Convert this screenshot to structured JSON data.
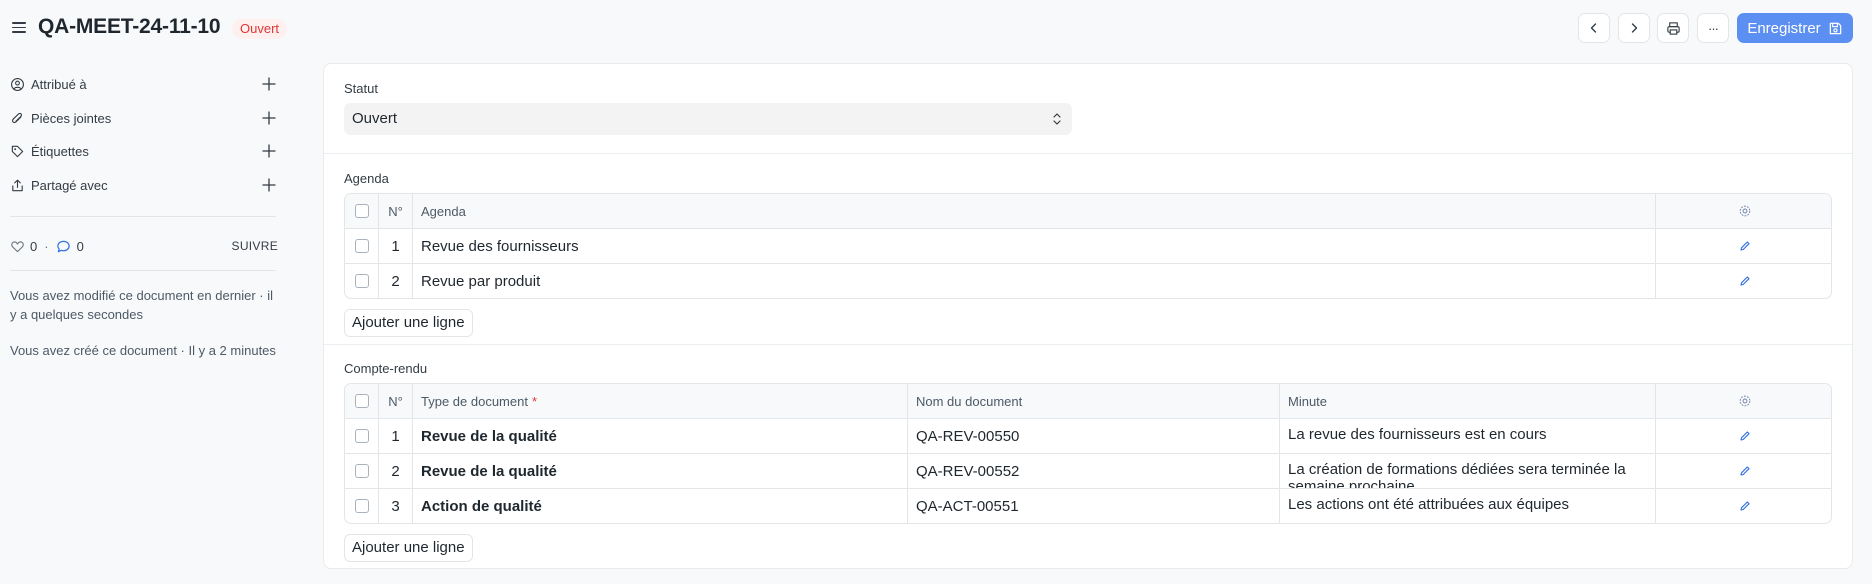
{
  "header": {
    "title": "QA-MEET-24-11-10",
    "status": "Ouvert",
    "save_label": "Enregistrer",
    "more_label": "···"
  },
  "sidebar": {
    "items": [
      {
        "label": "Attribué à",
        "icon": "user-assign-icon"
      },
      {
        "label": "Pièces jointes",
        "icon": "paperclip-icon"
      },
      {
        "label": "Étiquettes",
        "icon": "tag-icon"
      },
      {
        "label": "Partagé avec",
        "icon": "share-icon"
      }
    ],
    "likes": "0",
    "comments": "0",
    "separator": "·",
    "follow_label": "SUIVRE",
    "activity": [
      "Vous avez modifié ce document en dernier · il y a quelques secondes",
      "Vous avez créé ce document · Il y a 2 minutes"
    ]
  },
  "main": {
    "status_label": "Statut",
    "status_value": "Ouvert",
    "agenda": {
      "label": "Agenda",
      "columns": [
        "N°",
        "Agenda"
      ],
      "rows": [
        {
          "no": "1",
          "agenda": "Revue des fournisseurs"
        },
        {
          "no": "2",
          "agenda": "Revue par produit"
        }
      ],
      "add_label": "Ajouter une ligne"
    },
    "minutes": {
      "label": "Compte-rendu",
      "columns": [
        "N°",
        "Type de document",
        "Nom du document",
        "Minute"
      ],
      "required_mark": "*",
      "rows": [
        {
          "no": "1",
          "type": "Revue de la qualité",
          "name": "QA-REV-00550",
          "minute": "La revue des fournisseurs est en cours"
        },
        {
          "no": "2",
          "type": "Revue de la qualité",
          "name": "QA-REV-00552",
          "minute": "La création de formations dédiées sera terminée la semaine prochaine"
        },
        {
          "no": "3",
          "type": "Action de qualité",
          "name": "QA-ACT-00551",
          "minute": "Les actions ont été attribuées aux équipes"
        }
      ],
      "add_label": "Ajouter une ligne"
    }
  },
  "colors": {
    "accent": "#5c8ff2",
    "status_red": "#e03636",
    "status_bg": "#fff0f0"
  }
}
